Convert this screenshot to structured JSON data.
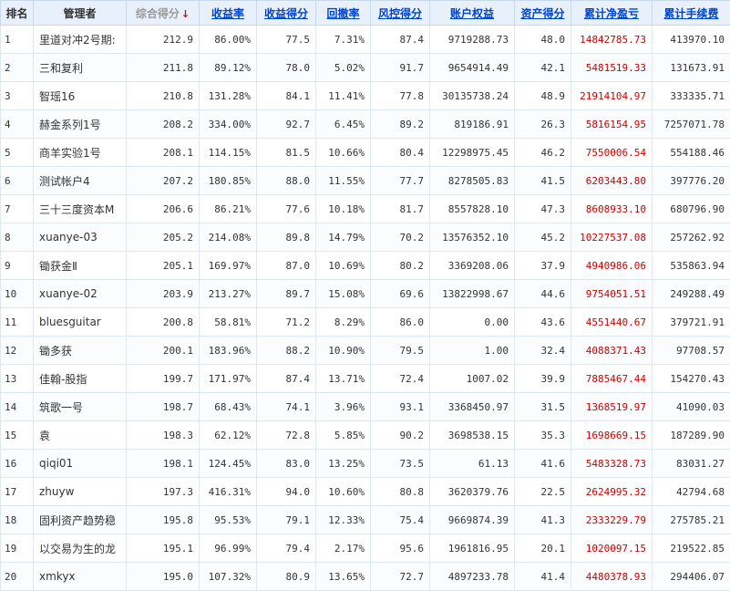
{
  "headers": {
    "rank": "排名",
    "manager": "管理者",
    "total_score": "综合得分",
    "sort_arrow": "↓",
    "return_rate": "收益率",
    "return_score": "收益得分",
    "drawdown": "回撤率",
    "risk_score": "风控得分",
    "equity": "账户权益",
    "asset_score": "资产得分",
    "net_profit": "累计净盈亏",
    "fees": "累计手续费"
  },
  "colors": {
    "header_bg": "#e8f1fb",
    "link": "#0044cc",
    "profit": "#cc0000",
    "sort_arrow": "#dd0000"
  },
  "rows": [
    {
      "rank": "1",
      "manager": "里道对冲2号期:",
      "total_score": "212.9",
      "return_rate": "86.00%",
      "return_score": "77.5",
      "drawdown": "7.31%",
      "risk_score": "87.4",
      "equity": "9719288.73",
      "asset_score": "48.0",
      "net_profit": "14842785.73",
      "fees": "413970.10"
    },
    {
      "rank": "2",
      "manager": "三和复利",
      "total_score": "211.8",
      "return_rate": "89.12%",
      "return_score": "78.0",
      "drawdown": "5.02%",
      "risk_score": "91.7",
      "equity": "9654914.49",
      "asset_score": "42.1",
      "net_profit": "5481519.33",
      "fees": "131673.91"
    },
    {
      "rank": "3",
      "manager": "智瑶16",
      "total_score": "210.8",
      "return_rate": "131.28%",
      "return_score": "84.1",
      "drawdown": "11.41%",
      "risk_score": "77.8",
      "equity": "30135738.24",
      "asset_score": "48.9",
      "net_profit": "21914104.97",
      "fees": "333335.71"
    },
    {
      "rank": "4",
      "manager": "赫金系列1号",
      "total_score": "208.2",
      "return_rate": "334.00%",
      "return_score": "92.7",
      "drawdown": "6.45%",
      "risk_score": "89.2",
      "equity": "819186.91",
      "asset_score": "26.3",
      "net_profit": "5816154.95",
      "fees": "7257071.78"
    },
    {
      "rank": "5",
      "manager": "商羊实验1号",
      "total_score": "208.1",
      "return_rate": "114.15%",
      "return_score": "81.5",
      "drawdown": "10.66%",
      "risk_score": "80.4",
      "equity": "12298975.45",
      "asset_score": "46.2",
      "net_profit": "7550006.54",
      "fees": "554188.46"
    },
    {
      "rank": "6",
      "manager": "测试帐户4",
      "total_score": "207.2",
      "return_rate": "180.85%",
      "return_score": "88.0",
      "drawdown": "11.55%",
      "risk_score": "77.7",
      "equity": "8278505.83",
      "asset_score": "41.5",
      "net_profit": "6203443.80",
      "fees": "397776.20"
    },
    {
      "rank": "7",
      "manager": "三十三度资本M",
      "total_score": "206.6",
      "return_rate": "86.21%",
      "return_score": "77.6",
      "drawdown": "10.18%",
      "risk_score": "81.7",
      "equity": "8557828.10",
      "asset_score": "47.3",
      "net_profit": "8608933.10",
      "fees": "680796.90"
    },
    {
      "rank": "8",
      "manager": "xuanye-03",
      "total_score": "205.2",
      "return_rate": "214.08%",
      "return_score": "89.8",
      "drawdown": "14.79%",
      "risk_score": "70.2",
      "equity": "13576352.10",
      "asset_score": "45.2",
      "net_profit": "10227537.08",
      "fees": "257262.92"
    },
    {
      "rank": "9",
      "manager": "锄获金Ⅱ",
      "total_score": "205.1",
      "return_rate": "169.97%",
      "return_score": "87.0",
      "drawdown": "10.69%",
      "risk_score": "80.2",
      "equity": "3369208.06",
      "asset_score": "37.9",
      "net_profit": "4940986.06",
      "fees": "535863.94"
    },
    {
      "rank": "10",
      "manager": "xuanye-02",
      "total_score": "203.9",
      "return_rate": "213.27%",
      "return_score": "89.7",
      "drawdown": "15.08%",
      "risk_score": "69.6",
      "equity": "13822998.67",
      "asset_score": "44.6",
      "net_profit": "9754051.51",
      "fees": "249288.49"
    },
    {
      "rank": "11",
      "manager": "bluesguitar",
      "total_score": "200.8",
      "return_rate": "58.81%",
      "return_score": "71.2",
      "drawdown": "8.29%",
      "risk_score": "86.0",
      "equity": "0.00",
      "asset_score": "43.6",
      "net_profit": "4551440.67",
      "fees": "379721.91"
    },
    {
      "rank": "12",
      "manager": "锄多获",
      "total_score": "200.1",
      "return_rate": "183.96%",
      "return_score": "88.2",
      "drawdown": "10.90%",
      "risk_score": "79.5",
      "equity": "1.00",
      "asset_score": "32.4",
      "net_profit": "4088371.43",
      "fees": "97708.57"
    },
    {
      "rank": "13",
      "manager": "佳翰-股指",
      "total_score": "199.7",
      "return_rate": "171.97%",
      "return_score": "87.4",
      "drawdown": "13.71%",
      "risk_score": "72.4",
      "equity": "1007.02",
      "asset_score": "39.9",
      "net_profit": "7885467.44",
      "fees": "154270.43"
    },
    {
      "rank": "14",
      "manager": "筑歌一号",
      "total_score": "198.7",
      "return_rate": "68.43%",
      "return_score": "74.1",
      "drawdown": "3.96%",
      "risk_score": "93.1",
      "equity": "3368450.97",
      "asset_score": "31.5",
      "net_profit": "1368519.97",
      "fees": "41090.03"
    },
    {
      "rank": "15",
      "manager": "袁",
      "total_score": "198.3",
      "return_rate": "62.12%",
      "return_score": "72.8",
      "drawdown": "5.85%",
      "risk_score": "90.2",
      "equity": "3698538.15",
      "asset_score": "35.3",
      "net_profit": "1698669.15",
      "fees": "187289.90"
    },
    {
      "rank": "16",
      "manager": "qiqi01",
      "total_score": "198.1",
      "return_rate": "124.45%",
      "return_score": "83.0",
      "drawdown": "13.25%",
      "risk_score": "73.5",
      "equity": "61.13",
      "asset_score": "41.6",
      "net_profit": "5483328.73",
      "fees": "83031.27"
    },
    {
      "rank": "17",
      "manager": "zhuyw",
      "total_score": "197.3",
      "return_rate": "416.31%",
      "return_score": "94.0",
      "drawdown": "10.60%",
      "risk_score": "80.8",
      "equity": "3620379.76",
      "asset_score": "22.5",
      "net_profit": "2624995.32",
      "fees": "42794.68"
    },
    {
      "rank": "18",
      "manager": "固利资产趋势稳",
      "total_score": "195.8",
      "return_rate": "95.53%",
      "return_score": "79.1",
      "drawdown": "12.33%",
      "risk_score": "75.4",
      "equity": "9669874.39",
      "asset_score": "41.3",
      "net_profit": "2333229.79",
      "fees": "275785.21"
    },
    {
      "rank": "19",
      "manager": "以交易为生的龙",
      "total_score": "195.1",
      "return_rate": "96.99%",
      "return_score": "79.4",
      "drawdown": "2.17%",
      "risk_score": "95.6",
      "equity": "1961816.95",
      "asset_score": "20.1",
      "net_profit": "1020097.15",
      "fees": "219522.85"
    },
    {
      "rank": "20",
      "manager": "xmkyx",
      "total_score": "195.0",
      "return_rate": "107.32%",
      "return_score": "80.9",
      "drawdown": "13.65%",
      "risk_score": "72.7",
      "equity": "4897233.78",
      "asset_score": "41.4",
      "net_profit": "4480378.93",
      "fees": "294406.07"
    }
  ]
}
